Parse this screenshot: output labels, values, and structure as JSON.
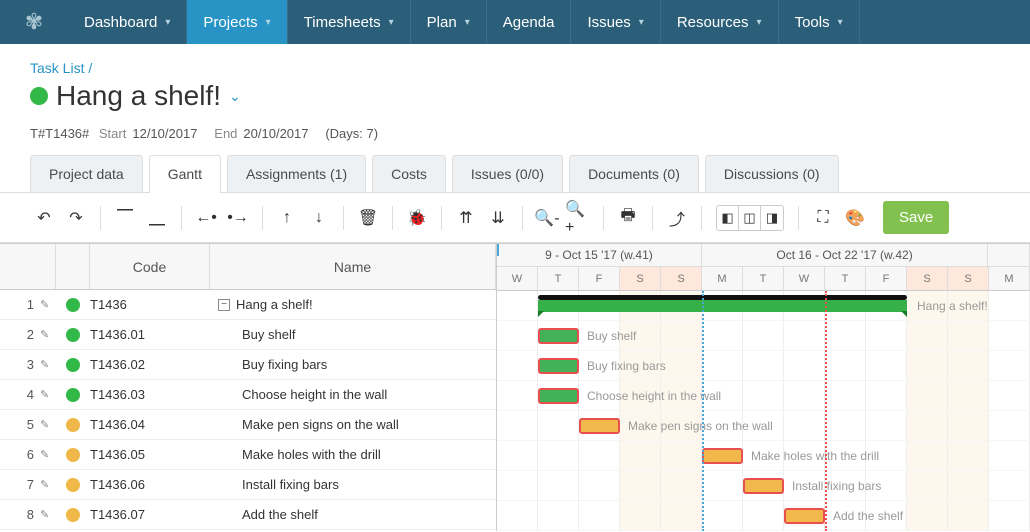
{
  "nav": {
    "items": [
      {
        "label": "Dashboard"
      },
      {
        "label": "Projects"
      },
      {
        "label": "Timesheets"
      },
      {
        "label": "Plan"
      },
      {
        "label": "Agenda"
      },
      {
        "label": "Issues"
      },
      {
        "label": "Resources"
      },
      {
        "label": "Tools"
      }
    ],
    "active_index": 1
  },
  "breadcrumb": "Task List /",
  "title": "Hang a shelf!",
  "meta": {
    "id_label": "T#T1436#",
    "start_label": "Start",
    "start": "12/10/2017",
    "end_label": "End",
    "end": "20/10/2017",
    "days": "(Days: 7)"
  },
  "tabs": [
    {
      "label": "Project data"
    },
    {
      "label": "Gantt"
    },
    {
      "label": "Assignments (1)"
    },
    {
      "label": "Costs"
    },
    {
      "label": "Issues (0/0)"
    },
    {
      "label": "Documents (0)"
    },
    {
      "label": "Discussions (0)"
    }
  ],
  "active_tab": 1,
  "toolbar": {
    "save": "Save"
  },
  "grid": {
    "headers": {
      "code": "Code",
      "name": "Name"
    },
    "rows": [
      {
        "idx": "1",
        "status": "green",
        "code": "T1436",
        "name": "Hang a shelf!",
        "collapse": true,
        "indent": 0
      },
      {
        "idx": "2",
        "status": "green",
        "code": "T1436.01",
        "name": "Buy shelf",
        "indent": 1
      },
      {
        "idx": "3",
        "status": "green",
        "code": "T1436.02",
        "name": "Buy fixing bars",
        "indent": 1
      },
      {
        "idx": "4",
        "status": "green",
        "code": "T1436.03",
        "name": "Choose height in the wall",
        "indent": 1
      },
      {
        "idx": "5",
        "status": "orange",
        "code": "T1436.04",
        "name": "Make pen signs on the wall",
        "indent": 1
      },
      {
        "idx": "6",
        "status": "orange",
        "code": "T1436.05",
        "name": "Make holes with the drill",
        "indent": 1
      },
      {
        "idx": "7",
        "status": "orange",
        "code": "T1436.06",
        "name": "Install fixing bars",
        "indent": 1
      },
      {
        "idx": "8",
        "status": "orange",
        "code": "T1436.07",
        "name": "Add the shelf",
        "indent": 1
      }
    ]
  },
  "timeline": {
    "weeks": [
      {
        "label": "9 - Oct 15 '17 (w.41)",
        "days": [
          "W",
          "T",
          "F",
          "S",
          "S"
        ]
      },
      {
        "label": "Oct 16 - Oct 22 '17 (w.42)",
        "days": [
          "M",
          "T",
          "W",
          "T",
          "F",
          "S",
          "S"
        ]
      },
      {
        "label": "",
        "days": [
          "M"
        ]
      }
    ],
    "weekend_indices": [
      3,
      4,
      10,
      11
    ],
    "red_line_day": 8,
    "blue_line_day": 5,
    "bars": [
      {
        "row": 0,
        "type": "summary",
        "start": 1,
        "span": 9,
        "label": "Hang a shelf!"
      },
      {
        "row": 1,
        "type": "green",
        "start": 1,
        "span": 1,
        "label": "Buy shelf"
      },
      {
        "row": 2,
        "type": "green",
        "start": 1,
        "span": 1,
        "label": "Buy fixing bars"
      },
      {
        "row": 3,
        "type": "green",
        "start": 1,
        "span": 1,
        "label": "Choose height in the wall"
      },
      {
        "row": 4,
        "type": "orange",
        "start": 2,
        "span": 1,
        "label": "Make pen signs on the wall"
      },
      {
        "row": 5,
        "type": "orange",
        "start": 5,
        "span": 1,
        "label": "Make holes with the drill"
      },
      {
        "row": 6,
        "type": "orange",
        "start": 6,
        "span": 1,
        "label": "Install fixing bars"
      },
      {
        "row": 7,
        "type": "orange",
        "start": 7,
        "span": 1,
        "label": "Add the shelf"
      }
    ]
  }
}
